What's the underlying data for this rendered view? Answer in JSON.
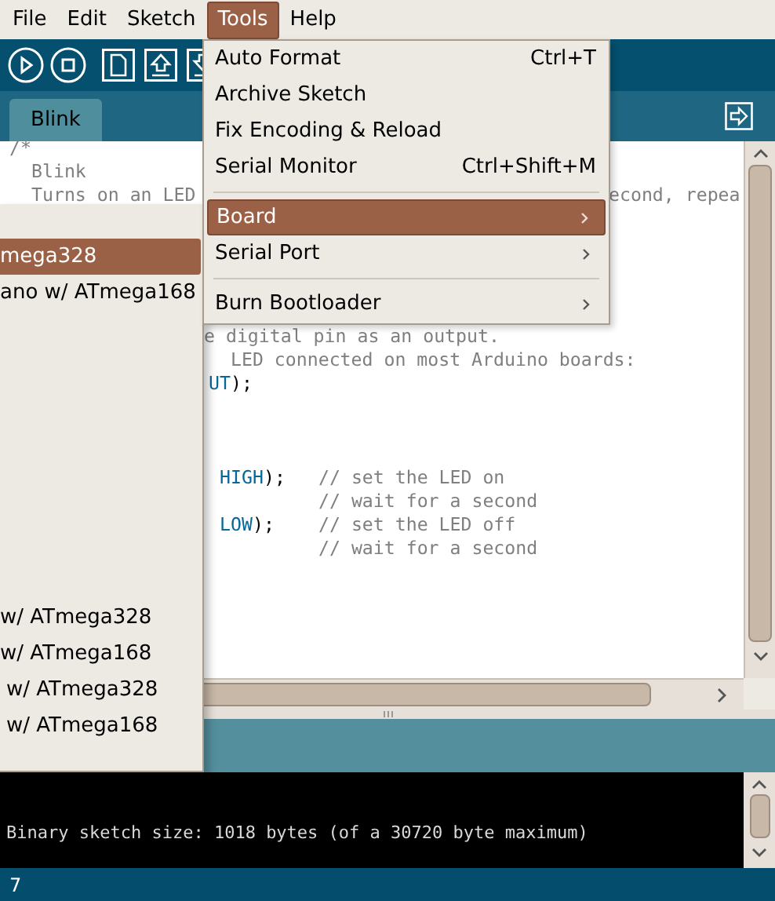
{
  "menu_bar": [
    {
      "label": "File",
      "selected": false
    },
    {
      "label": "Edit",
      "selected": false
    },
    {
      "label": "Sketch",
      "selected": false
    },
    {
      "label": "Tools",
      "selected": true
    },
    {
      "label": "Help",
      "selected": false
    }
  ],
  "tabs": [
    {
      "label": "Blink",
      "selected": true
    }
  ],
  "editor": {
    "lines": [
      {
        "segments": [
          {
            "text": "/*",
            "kind": "comment"
          }
        ]
      },
      {
        "segments": [
          {
            "text": "Blink",
            "kind": "comment"
          }
        ]
      },
      {
        "segments": [
          {
            "text": "Turns on an LED",
            "kind": "comment"
          },
          {
            "text": "econd, repea",
            "kind": "comment"
          }
        ]
      },
      {
        "segments": [
          {
            "text": "e digital pin as an output.",
            "kind": "comment"
          }
        ]
      },
      {
        "segments": [
          {
            "text": "LED connected on most Arduino boards:",
            "kind": "comment"
          }
        ]
      },
      {
        "segments": [
          {
            "text": "UT",
            "kind": "keyword"
          },
          {
            "text": ");",
            "kind": "plain"
          }
        ]
      },
      {
        "segments": [
          {
            "text": "HIGH",
            "kind": "keyword"
          },
          {
            "text": ");",
            "kind": "plain"
          },
          {
            "text": "// set the LED on",
            "kind": "comment"
          }
        ]
      },
      {
        "segments": [
          {
            "text": "// wait for a second",
            "kind": "comment"
          }
        ]
      },
      {
        "segments": [
          {
            "text": "LOW",
            "kind": "keyword"
          },
          {
            "text": ");",
            "kind": "plain"
          },
          {
            "text": "// set the LED off",
            "kind": "comment"
          }
        ]
      },
      {
        "segments": [
          {
            "text": "// wait for a second",
            "kind": "comment"
          }
        ]
      }
    ]
  },
  "console": {
    "lines": [
      "Binary sketch size: 1018 bytes (of a 30720 byte maximum)"
    ]
  },
  "status_bar": {
    "line": "7"
  },
  "tools_menu": {
    "items": [
      {
        "kind": "item",
        "label": "Auto Format",
        "shortcut": "Ctrl+T",
        "submenu": false,
        "selected": false
      },
      {
        "kind": "item",
        "label": "Archive Sketch",
        "submenu": false,
        "selected": false
      },
      {
        "kind": "item",
        "label": "Fix Encoding & Reload",
        "submenu": false,
        "selected": false
      },
      {
        "kind": "item",
        "label": "Serial Monitor",
        "shortcut": "Ctrl+Shift+M",
        "submenu": false,
        "selected": false
      },
      {
        "kind": "separator"
      },
      {
        "kind": "item",
        "label": "Board",
        "submenu": true,
        "selected": true
      },
      {
        "kind": "item",
        "label": "Serial Port",
        "submenu": true,
        "selected": false
      },
      {
        "kind": "separator"
      },
      {
        "kind": "item",
        "label": "Burn Bootloader",
        "submenu": true,
        "selected": false
      }
    ]
  },
  "board_menu": {
    "items": [
      {
        "label": "mega328",
        "selected": true
      },
      {
        "label": "ano w/ ATmega168",
        "selected": false
      },
      {
        "label": "w/ ATmega328",
        "selected": false
      },
      {
        "label": "w/ ATmega168",
        "selected": false
      },
      {
        "label": "w/ ATmega328",
        "selected": false
      },
      {
        "label": "w/ ATmega168",
        "selected": false
      }
    ]
  }
}
